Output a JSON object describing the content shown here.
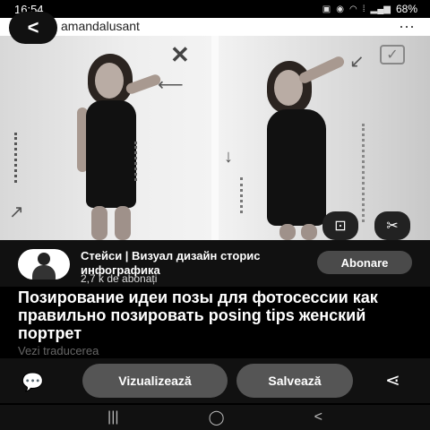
{
  "status_bar": {
    "time": "16:54",
    "battery": "68%",
    "icons": [
      "photo-icon",
      "whatsapp-icon",
      "wifi-icon",
      "volte-icon",
      "signal-icon",
      "battery-icon"
    ]
  },
  "header": {
    "username": "amandalusant",
    "more_icon": "⋯"
  },
  "image": {
    "x_mark": "✕",
    "check_mark": "✓",
    "lens_icon": "⊡",
    "scissors_icon": "✂"
  },
  "creator": {
    "name": "Стейси | Визуал дизайн сторис инфографика",
    "followers": "2,7 k de abonați",
    "follow_label": "Abonare"
  },
  "pin": {
    "title": "Позирование идеи позы для фотосессии как правильно позировать posing tips женский портрет",
    "translate_label": "Vezi traducerea"
  },
  "actions": {
    "view_label": "Vizualizează",
    "save_label": "Salvează"
  },
  "nav": {
    "recent": "|||",
    "home": "◯",
    "back": "<"
  },
  "colors": {
    "background": "#000000",
    "button_bg": "#555555",
    "follow_bg": "#4a4a4a",
    "muted_text": "#666666"
  }
}
